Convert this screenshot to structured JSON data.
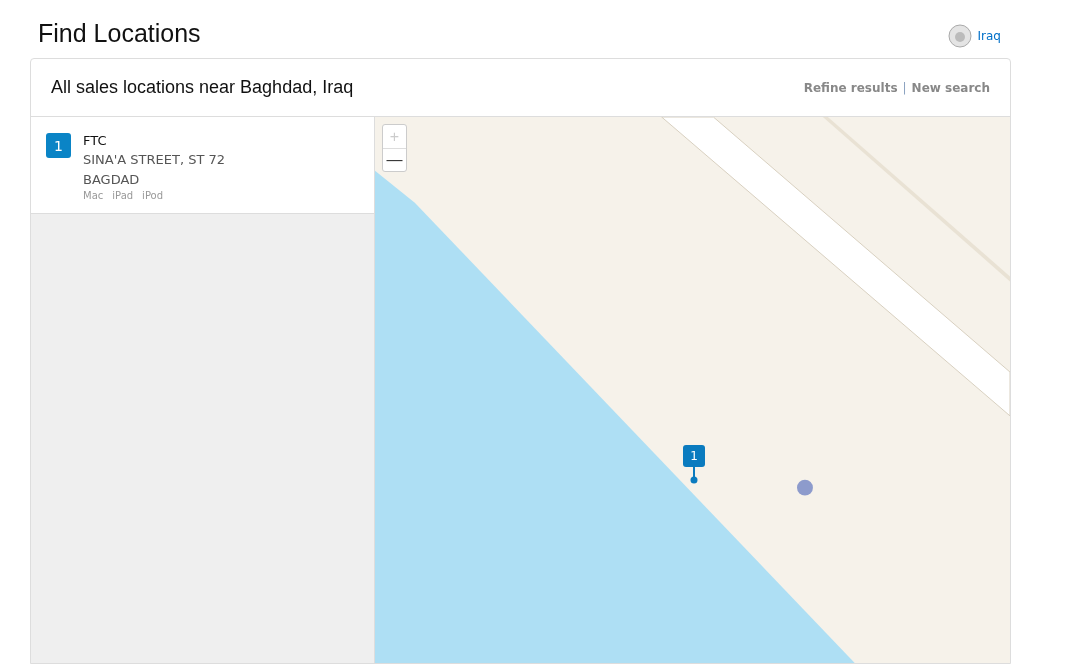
{
  "page": {
    "title": "Find Locations",
    "country": "Iraq"
  },
  "results": {
    "heading": "All sales locations near Baghdad, Iraq",
    "links": [
      "Refine results",
      "New search"
    ],
    "separator": "|"
  },
  "locations": [
    {
      "number": "1",
      "name": "FTC",
      "address": [
        "SINA'A STREET, ST 72",
        "BAGDAD"
      ],
      "products": [
        "Mac",
        "iPad",
        "iPod"
      ]
    }
  ],
  "map": {
    "kind": "picture",
    "zoom_in": "+",
    "zoom_out": "—",
    "markers": [
      {
        "label": "1"
      }
    ]
  }
}
